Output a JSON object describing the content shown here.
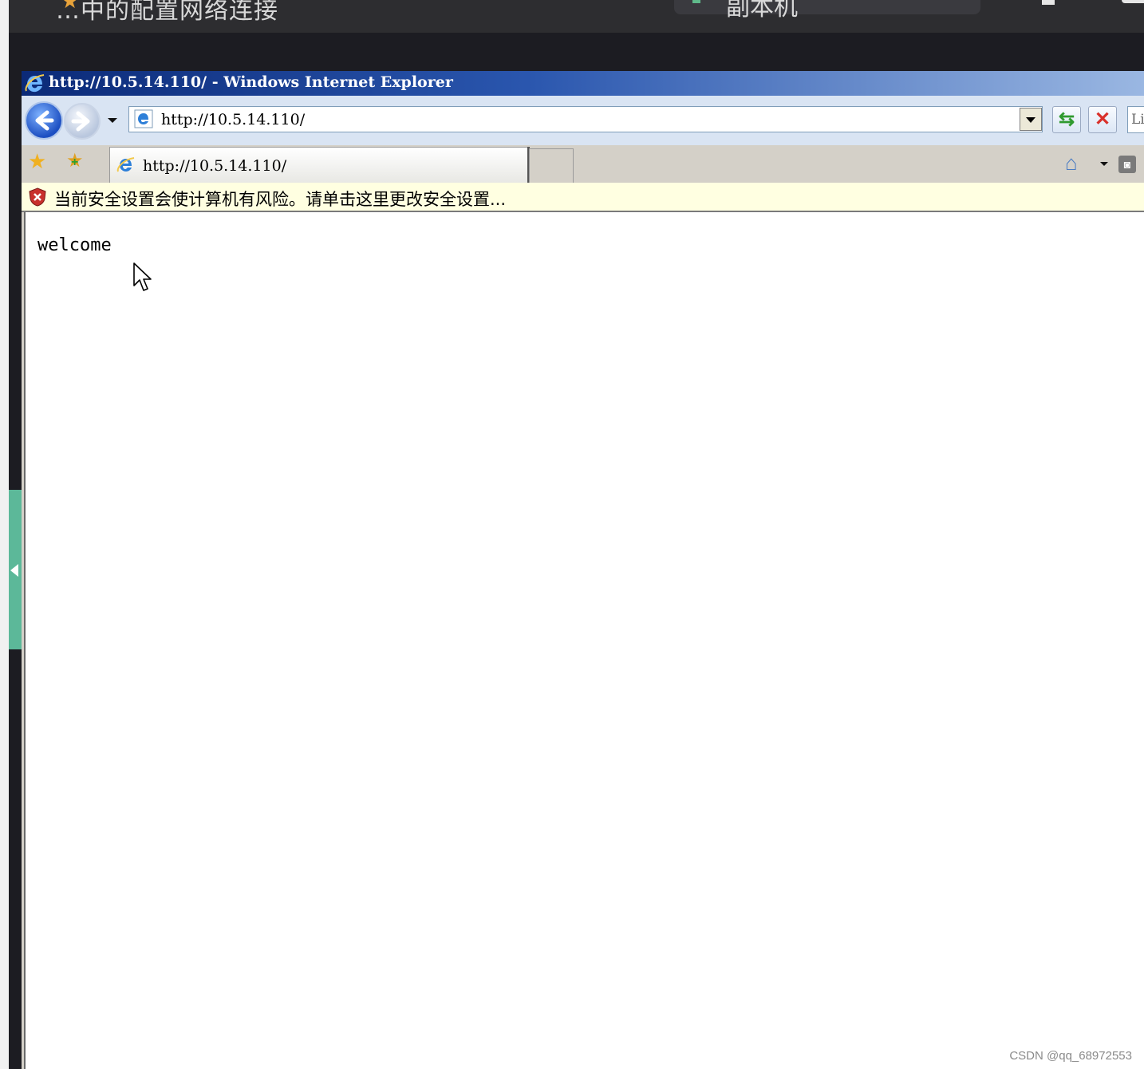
{
  "host": {
    "title": "…中的配置网络连接",
    "tab_label": "副本机"
  },
  "ie": {
    "window_title": "http://10.5.14.110/ - Windows Internet Explorer",
    "address": "http://10.5.14.110/",
    "search_placeholder": "Li",
    "tab_title": "http://10.5.14.110/",
    "infobar_message": "当前安全设置会使计算机有风险。请单击这里更改安全设置...",
    "page_text": "welcome"
  },
  "icons": {
    "back": "back-arrow-icon",
    "forward": "forward-arrow-icon",
    "refresh": "refresh-icon",
    "stop": "stop-icon",
    "favorites": "favorites-star-icon",
    "add_favorites": "add-favorites-icon",
    "home": "home-icon",
    "feeds": "feeds-icon",
    "security_warning": "shield-warning-icon"
  },
  "colors": {
    "titlebar": "#0b2a78",
    "infobar": "#ffffe1",
    "side_handle": "#5cb899"
  },
  "watermark": "CSDN @qq_68972553"
}
